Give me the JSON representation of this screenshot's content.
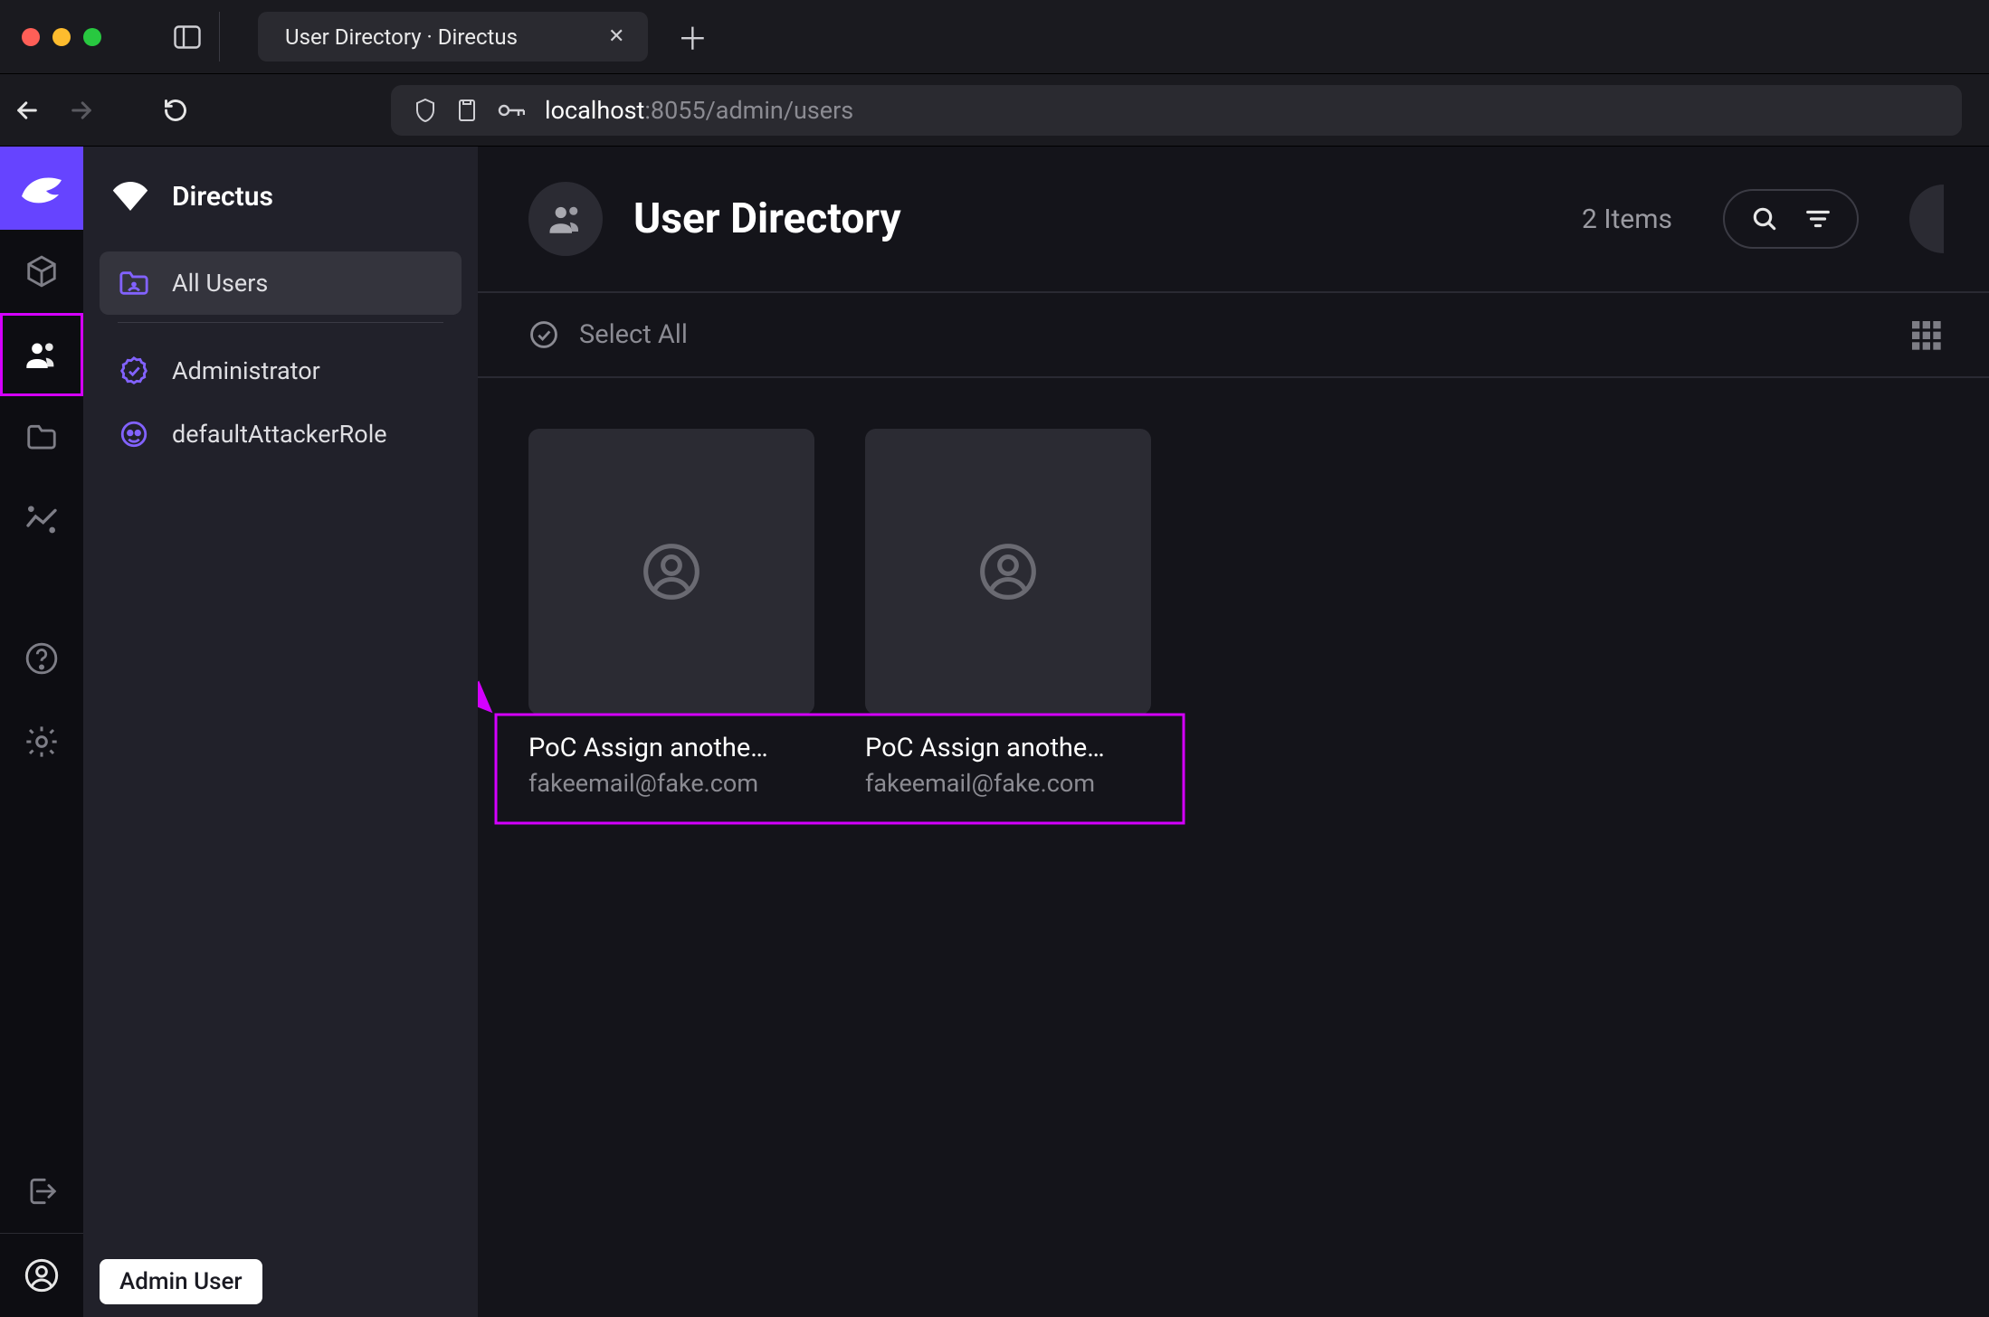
{
  "browser": {
    "tab_title": "User Directory · Directus",
    "url_host": "localhost",
    "url_port_path": ":8055/admin/users"
  },
  "module_rail": {
    "logo_label": "Directus",
    "items": [
      {
        "name": "content",
        "icon": "box"
      },
      {
        "name": "users",
        "icon": "people",
        "active": true
      },
      {
        "name": "files",
        "icon": "folder"
      },
      {
        "name": "insights",
        "icon": "sparkline"
      },
      {
        "name": "docs",
        "icon": "help"
      },
      {
        "name": "settings",
        "icon": "gear"
      }
    ],
    "footer": {
      "signout_icon": "signout",
      "profile_icon": "account",
      "profile_tooltip": "Admin User"
    }
  },
  "nav_panel": {
    "title": "Directus",
    "items": [
      {
        "icon": "users-folder",
        "label": "All Users",
        "selected": true
      },
      {
        "icon": "verified",
        "label": "Administrator"
      },
      {
        "icon": "mask",
        "label": "defaultAttackerRole"
      }
    ]
  },
  "page": {
    "title": "User Directory",
    "item_count_label": "2 Items",
    "select_all_label": "Select All"
  },
  "users": [
    {
      "name": "PoC Assign anothe…",
      "email": "fakeemail@fake.com"
    },
    {
      "name": "PoC Assign anothe…",
      "email": "fakeemail@fake.com"
    }
  ],
  "colors": {
    "accent": "#6644ff",
    "annotation": "#d400ff"
  }
}
